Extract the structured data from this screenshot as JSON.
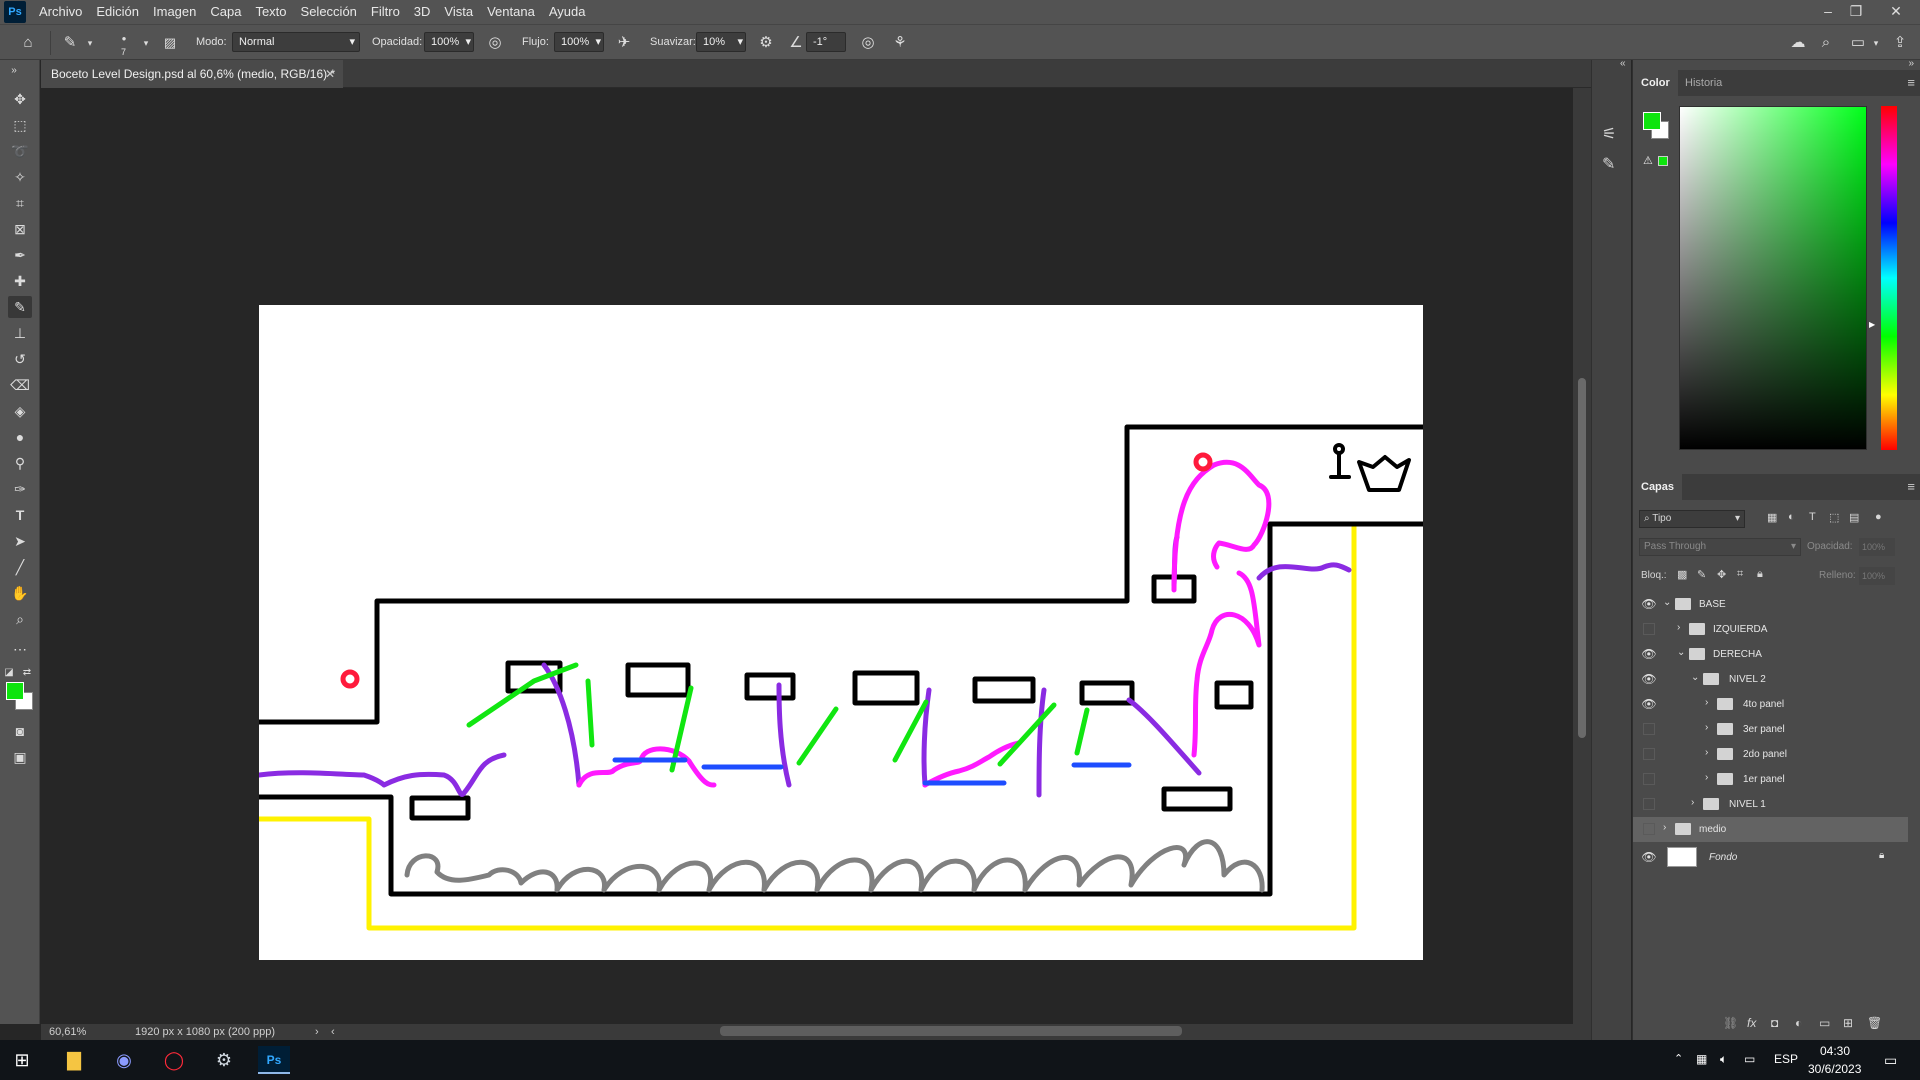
{
  "menubar": {
    "logo": "Ps",
    "items": [
      "Archivo",
      "Edición",
      "Imagen",
      "Capa",
      "Texto",
      "Selección",
      "Filtro",
      "3D",
      "Vista",
      "Ventana",
      "Ayuda"
    ]
  },
  "optbar": {
    "brush_size": "7",
    "mode_label": "Modo:",
    "mode_value": "Normal",
    "opacity_label": "Opacidad:",
    "opacity_value": "100%",
    "flow_label": "Flujo:",
    "flow_value": "100%",
    "smoothing_label": "Suavizar:",
    "smoothing_value": "10%",
    "angle_value": "-1°"
  },
  "document": {
    "tab_title": "Boceto Level Design.psd al 60,6% (medio, RGB/16) *",
    "zoom": "60,61%",
    "dimensions": "1920 px x 1080 px (200 ppp)"
  },
  "color_panel": {
    "tabs": [
      "Color",
      "Historia"
    ],
    "foreground": "#0ee40e",
    "background": "#ffffff"
  },
  "layers_panel": {
    "title": "Capas",
    "filter_kind": "Tipo",
    "blend_mode": "Pass Through",
    "opacity_label": "Opacidad:",
    "opacity_value": "100%",
    "lock_label": "Bloq.:",
    "fill_label": "Relleno:",
    "fill_value": "100%",
    "layers": [
      {
        "name": "BASE",
        "visible": true,
        "expanded": true
      },
      {
        "name": "IZQUIERDA",
        "visible": false,
        "expanded": false
      },
      {
        "name": "DERECHA",
        "visible": true,
        "expanded": true
      },
      {
        "name": "NIVEL 2",
        "visible": true,
        "expanded": true
      },
      {
        "name": "4to panel",
        "visible": true,
        "expanded": false
      },
      {
        "name": "3er panel",
        "visible": false,
        "expanded": false
      },
      {
        "name": "2do panel",
        "visible": false,
        "expanded": false
      },
      {
        "name": "1er panel",
        "visible": false,
        "expanded": false
      },
      {
        "name": "NIVEL 1",
        "visible": false,
        "expanded": false
      },
      {
        "name": "medio",
        "visible": false,
        "expanded": false
      },
      {
        "name": "Fondo",
        "visible": true,
        "expanded": false
      }
    ]
  },
  "taskbar": {
    "language": "ESP",
    "time": "04:30",
    "date": "30/6/2023"
  },
  "sketch_colors": {
    "wall": "#000000",
    "jump": "#8a2be2",
    "alt_jump": "#ff1aff",
    "climb": "#11e611",
    "walk": "#1e4dff",
    "bound": "#fff200",
    "spikes": "#808080",
    "marker": "#ff1a3c"
  }
}
